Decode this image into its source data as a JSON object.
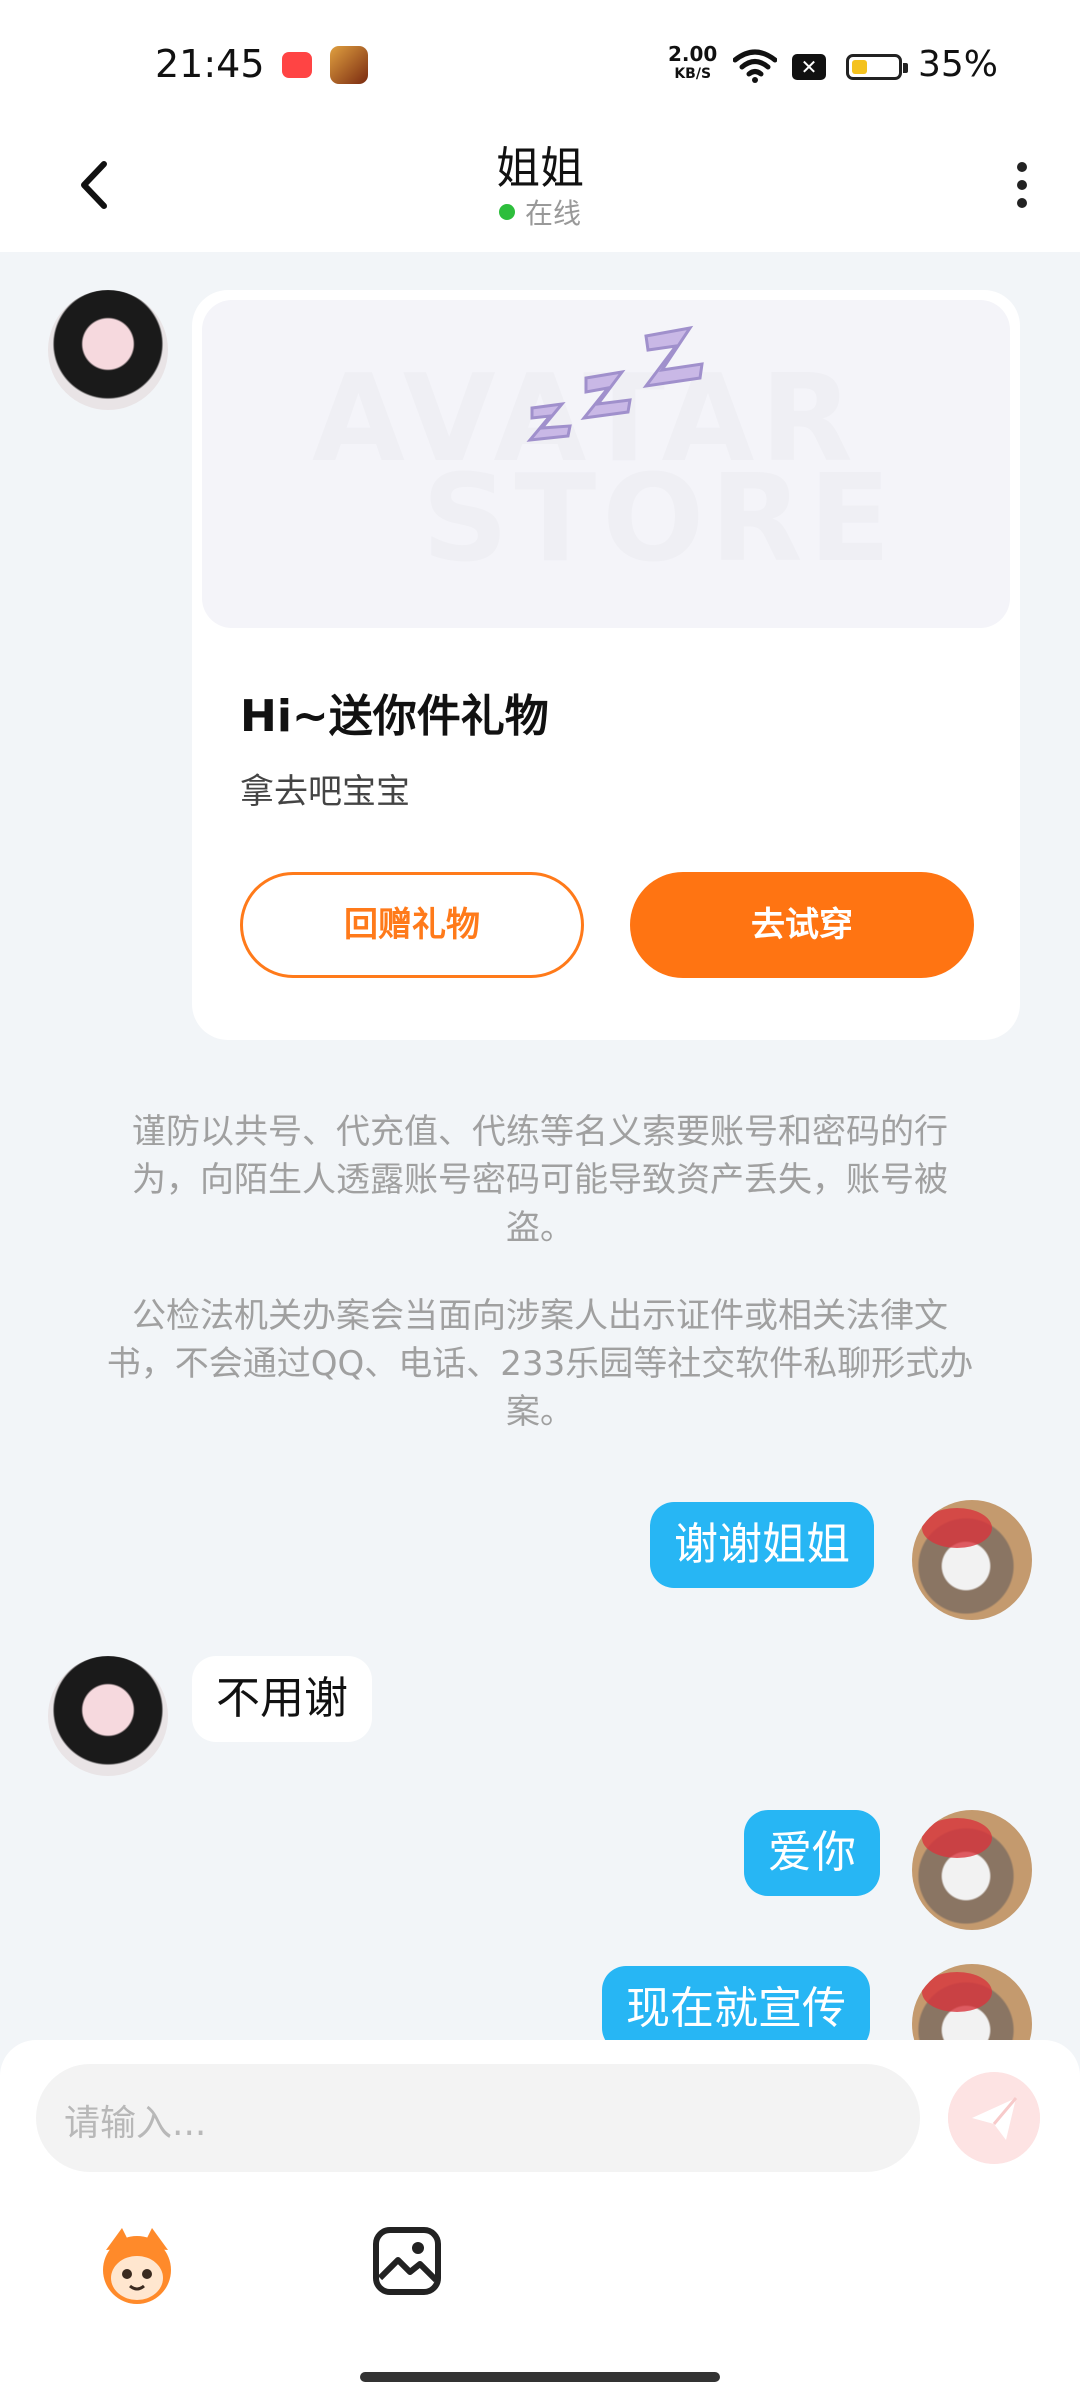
{
  "status_bar": {
    "time": "21:45",
    "net_speed_value": "2.00",
    "net_speed_unit": "KB/S",
    "battery_percent": "35%",
    "battery_level": 0.35
  },
  "header": {
    "title": "姐姐",
    "presence": "在线"
  },
  "gift_card": {
    "watermark_line1": "AVATAR",
    "watermark_line2": "STORE",
    "title": "Hi~送你件礼物",
    "subtitle": "拿去吧宝宝",
    "return_gift_label": "回赠礼物",
    "try_on_label": "去试穿"
  },
  "notices": [
    "谨防以共号、代充值、代练等名义索要账号和密码的行为，向陌生人透露账号密码可能导致资产丢失，账号被盗。",
    "公检法机关办案会当面向涉案人出示证件或相关法律文书，不会通过QQ、电话、233乐园等社交软件私聊形式办案。"
  ],
  "messages": [
    {
      "from": "me",
      "text": "谢谢姐姐"
    },
    {
      "from": "other",
      "text": "不用谢"
    },
    {
      "from": "me",
      "text": "爱你"
    },
    {
      "from": "me",
      "text": "现在就宣传"
    }
  ],
  "input": {
    "placeholder": "请输入..."
  },
  "colors": {
    "accent_orange": "#FF7412",
    "bubble_blue": "#27B6F4",
    "online_green": "#2DBE3C"
  }
}
